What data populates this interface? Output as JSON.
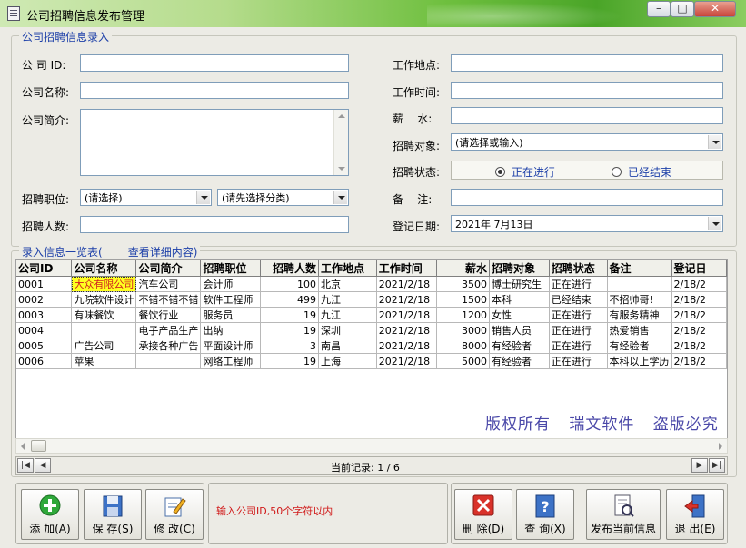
{
  "window": {
    "title": "公司招聘信息发布管理"
  },
  "form": {
    "legend": "公司招聘信息录入",
    "company_id_label": "公 司 ID:",
    "company_id_value": "",
    "company_name_label": "公司名称:",
    "company_name_value": "",
    "company_intro_label": "公司简介:",
    "company_intro_value": "",
    "position_label": "招聘职位:",
    "position_select": "(请选择)",
    "category_select": "(请先选择分类)",
    "count_label": "招聘人数:",
    "count_value": "",
    "location_label": "工作地点:",
    "location_value": "",
    "worktime_label": "工作时间:",
    "worktime_value": "",
    "salary_label": "薪    水:",
    "salary_value": "",
    "target_label": "招聘对象:",
    "target_select": "(请选择或输入)",
    "status_label": "招聘状态:",
    "status_options": [
      "正在进行",
      "已经结束"
    ],
    "status_selected": "正在进行",
    "remark_label": "备    注:",
    "remark_value": "",
    "date_label": "登记日期:",
    "date_value": "2021年 7月13日"
  },
  "list": {
    "legend_prefix": "录入信息一览表(",
    "legend_suffix": "查看详细内容)",
    "columns": [
      "公司ID",
      "公司名称",
      "公司简介",
      "招聘职位",
      "招聘人数",
      "工作地点",
      "工作时间",
      "薪水",
      "招聘对象",
      "招聘状态",
      "备注",
      "登记日"
    ],
    "rows": [
      [
        "0001",
        "大众有限公司",
        "汽车公司",
        "会计师",
        "100",
        "北京",
        "2021/2/18",
        "3500",
        "博士研究生",
        "正在进行",
        "",
        "2/18/2"
      ],
      [
        "0002",
        "九院软件设计",
        "不错不错不错",
        "软件工程师",
        "499",
        "九江",
        "2021/2/18",
        "1500",
        "本科",
        "已经结束",
        "不招帅哥!",
        "2/18/2"
      ],
      [
        "0003",
        "有味餐饮",
        "餐饮行业",
        "服务员",
        "19",
        "九江",
        "2021/2/18",
        "1200",
        "女性",
        "正在进行",
        "有服务精神",
        "2/18/2"
      ],
      [
        "0004",
        "",
        "电子产品生产",
        "出纳",
        "19",
        "深圳",
        "2021/2/18",
        "3000",
        "销售人员",
        "正在进行",
        "热爱销售",
        "2/18/2"
      ],
      [
        "0005",
        "广告公司",
        "承接各种广告",
        "平面设计师",
        "3",
        "南昌",
        "2021/2/18",
        "8000",
        "有经验者",
        "正在进行",
        "有经验者",
        "2/18/2"
      ],
      [
        "0006",
        "苹果",
        "",
        "网络工程师",
        "19",
        "上海",
        "2021/2/18",
        "5000",
        "有经验者",
        "正在进行",
        "本科以上学历",
        "2/18/2"
      ]
    ],
    "copyright": "版权所有 瑞文软件 盗版必究"
  },
  "navigator": {
    "record_text": "当前记录: 1 / 6"
  },
  "toolbar": {
    "add": "添 加(A)",
    "save": "保 存(S)",
    "edit": "修 改(C)",
    "hint": "输入公司ID,50个字符以内",
    "delete": "删 除(D)",
    "query": "查 询(X)",
    "publish": "发布当前信息",
    "exit": "退 出(E)"
  }
}
